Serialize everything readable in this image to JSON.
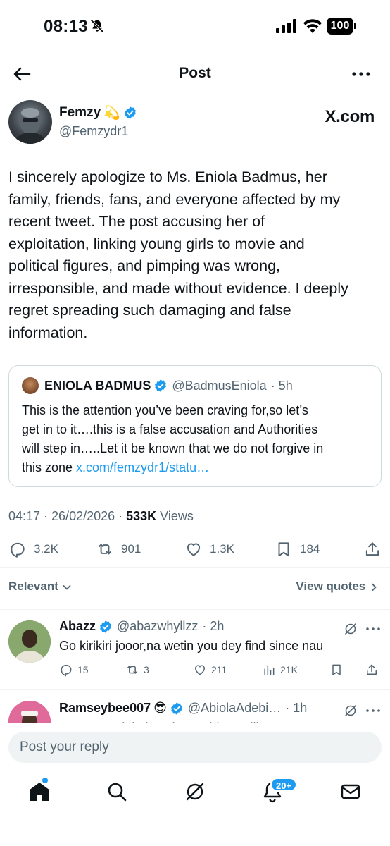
{
  "status_bar": {
    "time": "08:13",
    "battery": "100"
  },
  "header": {
    "title": "Post"
  },
  "author": {
    "name": "Femzy",
    "name_emoji": "💫",
    "handle": "@Femzydr1",
    "source": "X.com"
  },
  "tweet": {
    "lines": [
      "I sincerely apologize to Ms. Eniola Badmus, her",
      "family, friends, fans, and everyone affected by my",
      "recent tweet. The post accusing her of",
      "exploitation, linking young girls to movie and",
      "political figures, and pimping was wrong,",
      "irresponsible, and made without evidence. I deeply",
      "regret spreading such damaging and false",
      "information."
    ]
  },
  "quote": {
    "name": "ENIOLA BADMUS",
    "handle": "@BadmusEniola",
    "age": "· 5h",
    "lines": [
      "This is the attention you’ve been craving for,so let’s",
      "get in to it….this is a false accusation and Authorities",
      "will step in…..Let it be known that we do not forgive in",
      "this zone "
    ],
    "link": "x.com/femzydr1/statu…"
  },
  "meta": {
    "time": "04:17 · 26/02/2026 · ",
    "views_count": "533K",
    "views_label": " Views"
  },
  "actions": {
    "replies": "3.2K",
    "reposts": "901",
    "likes": "1.3K",
    "bookmarks": "184"
  },
  "filters": {
    "relevant": "Relevant",
    "view_quotes": "View quotes"
  },
  "replies": [
    {
      "name": "Abazz",
      "handle": "@abazwhyllzz",
      "age": "· 2h",
      "text": "Go kirikiri jooor,na wetin you dey find since nau",
      "replies": "15",
      "reposts": "3",
      "likes": "211",
      "views": "21K"
    },
    {
      "name": "Ramseybee007",
      "name_emoji": "😎",
      "handle": "@AbiolaAdebi…",
      "age": "· 1h",
      "text": "You go explain last they said go still"
    }
  ],
  "composer": {
    "placeholder": "Post your reply"
  },
  "nav": {
    "notifications_badge": "20+"
  },
  "colors": {
    "accent": "#1d9bf0",
    "text": "#0f1419",
    "muted": "#536471"
  }
}
